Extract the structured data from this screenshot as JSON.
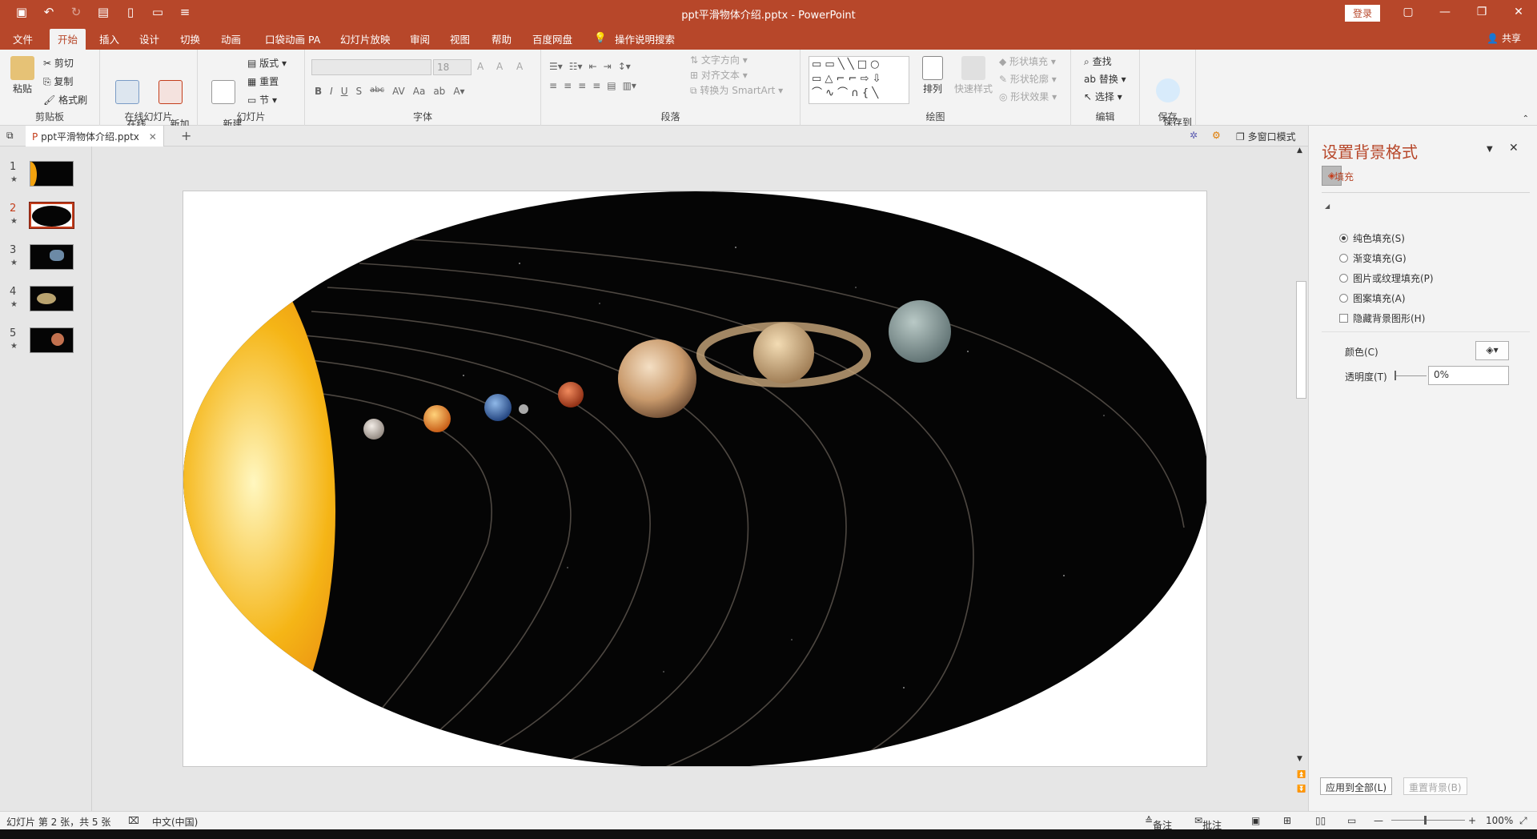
{
  "titlebar": {
    "title": "ppt平滑物体介绍.pptx  -  PowerPoint",
    "login": "登录"
  },
  "menu": {
    "tabs": [
      "文件",
      "开始",
      "插入",
      "设计",
      "切换",
      "动画",
      "口袋动画 PA",
      "幻灯片放映",
      "审阅",
      "视图",
      "帮助",
      "百度网盘",
      "操作说明搜索"
    ],
    "share": "共享"
  },
  "ribbon": {
    "clipboard": {
      "paste": "粘贴",
      "cut": "剪切",
      "copy": "复制",
      "format_painter": "格式刷",
      "label": "剪贴板"
    },
    "online": {
      "online_slide": "在线\n幻灯片",
      "new_anim": "新加\n动画页",
      "label": "在线幻灯片"
    },
    "slides": {
      "new_slide": "新建\n幻灯片",
      "layout": "版式",
      "reset": "重置",
      "section": "节",
      "label": "幻灯片"
    },
    "font": {
      "size": "18",
      "label": "字体",
      "bold": "B",
      "italic": "I",
      "underline": "U",
      "shadow": "S",
      "strike": "abc",
      "spacing": "AV",
      "case": "Aa",
      "grow": "A",
      "shrink": "A",
      "clear": "A"
    },
    "paragraph": {
      "text_dir": "文字方向",
      "align_text": "对齐文本",
      "smartart": "转换为 SmartArt",
      "label": "段落"
    },
    "drawing": {
      "arrange": "排列",
      "quick_styles": "快速样式",
      "shape_fill": "形状填充",
      "shape_outline": "形状轮廓",
      "shape_effects": "形状效果",
      "label": "绘图"
    },
    "editing": {
      "find": "查找",
      "replace": "替换",
      "select": "选择",
      "label": "编辑"
    },
    "save": {
      "save_baidu": "保存到\n百度网盘",
      "label": "保存"
    }
  },
  "tabstrip": {
    "doc": "ppt平滑物体介绍.pptx",
    "multi": "多窗口模式"
  },
  "thumbs": [
    {
      "n": "1"
    },
    {
      "n": "2"
    },
    {
      "n": "3"
    },
    {
      "n": "4"
    },
    {
      "n": "5"
    }
  ],
  "sidepane": {
    "title": "设置背景格式",
    "section": "填充",
    "options": [
      "纯色填充(S)",
      "渐变填充(G)",
      "图片或纹理填充(P)",
      "图案填充(A)"
    ],
    "hide_bg": "隐藏背景图形(H)",
    "color_label": "颜色(C)",
    "transparency_label": "透明度(T)",
    "transparency_value": "0%",
    "apply_all": "应用到全部(L)",
    "reset_bg": "重置背景(B)"
  },
  "status": {
    "slide_info": "幻灯片 第 2 张，共 5 张",
    "lang": "中文(中国)",
    "notes": "备注",
    "comments": "批注",
    "zoom": "100%"
  }
}
